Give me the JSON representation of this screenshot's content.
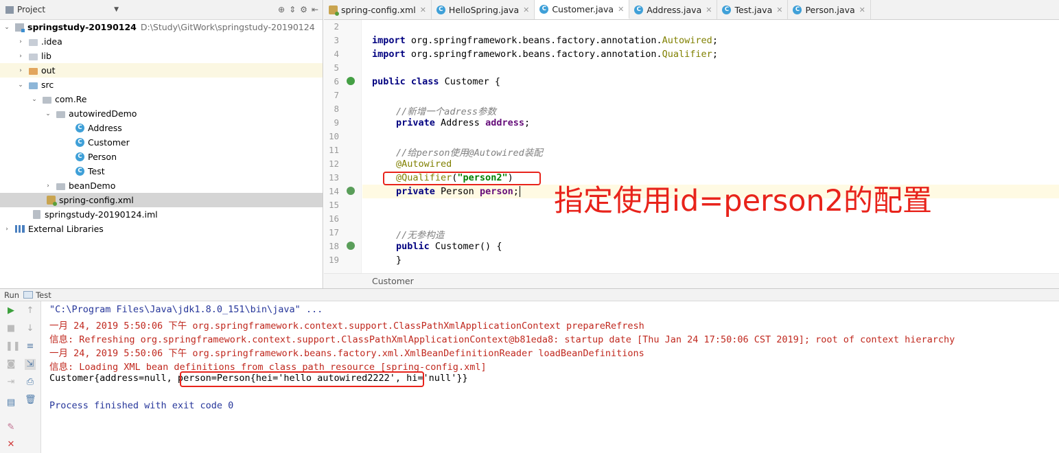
{
  "project": {
    "title": "Project",
    "root": "springstudy-20190124",
    "root_path": "D:\\Study\\GitWork\\springstudy-20190124",
    "items": [
      {
        "label": ".idea"
      },
      {
        "label": "lib"
      },
      {
        "label": "out"
      },
      {
        "label": "src"
      },
      {
        "label": "com.Re"
      },
      {
        "label": "autowiredDemo"
      },
      {
        "label": "Address"
      },
      {
        "label": "Customer"
      },
      {
        "label": "Person"
      },
      {
        "label": "Test"
      },
      {
        "label": "beanDemo"
      },
      {
        "label": "spring-config.xml"
      },
      {
        "label": "springstudy-20190124.iml"
      },
      {
        "label": "External Libraries"
      }
    ]
  },
  "tabs": [
    {
      "label": "spring-config.xml"
    },
    {
      "label": "HelloSpring.java"
    },
    {
      "label": "Customer.java"
    },
    {
      "label": "Address.java"
    },
    {
      "label": "Test.java"
    },
    {
      "label": "Person.java"
    }
  ],
  "editor": {
    "line_numbers": [
      "2",
      "3",
      "4",
      "5",
      "6",
      "7",
      "8",
      "9",
      "10",
      "11",
      "12",
      "13",
      "14",
      "15",
      "16",
      "17",
      "18",
      "19"
    ],
    "breadcrumb": "Customer",
    "lines": {
      "l3": {
        "kw": "import",
        "pkg": " org.springframework.beans.factory.annotation.",
        "cls": "Autowired",
        "end": ";"
      },
      "l4": {
        "kw": "import",
        "pkg": " org.springframework.beans.factory.annotation.",
        "cls": "Qualifier",
        "end": ";"
      },
      "l6": {
        "kw": "public class",
        "rest": " Customer {"
      },
      "l8": "//新增一个adress参数",
      "l9": {
        "kw": "private",
        "type": " Address ",
        "field": "address",
        "end": ";"
      },
      "l11": "//给person使用@Autowired装配",
      "l12": "@Autowired",
      "l13": {
        "ann": "@Qualifier",
        "open": "(",
        "str": "\"person2\"",
        "close": ")"
      },
      "l14": {
        "kw": "private",
        "type": " Person ",
        "field": "person",
        "end": ";"
      },
      "l17": "//无参构造",
      "l18": {
        "kw": "public",
        "rest": " Customer() {"
      },
      "l19": "}"
    }
  },
  "annotation_note": "指定使用id=person2的配置",
  "run": {
    "label": "Run",
    "config": "Test",
    "console": [
      "\"C:\\Program Files\\Java\\jdk1.8.0_151\\bin\\java\" ...",
      "一月 24, 2019 5:50:06 下午 org.springframework.context.support.ClassPathXmlApplicationContext prepareRefresh",
      "信息: Refreshing org.springframework.context.support.ClassPathXmlApplicationContext@b81eda8: startup date [Thu Jan 24 17:50:06 CST 2019]; root of context hierarchy",
      "一月 24, 2019 5:50:06 下午 org.springframework.beans.factory.xml.XmlBeanDefinitionReader loadBeanDefinitions",
      "信息: Loading XML bean definitions from class path resource [spring-config.xml]",
      "Customer{address=null, person=Person{hei='hello autowired2222', hi='null'}}",
      "Process finished with exit code 0"
    ]
  }
}
